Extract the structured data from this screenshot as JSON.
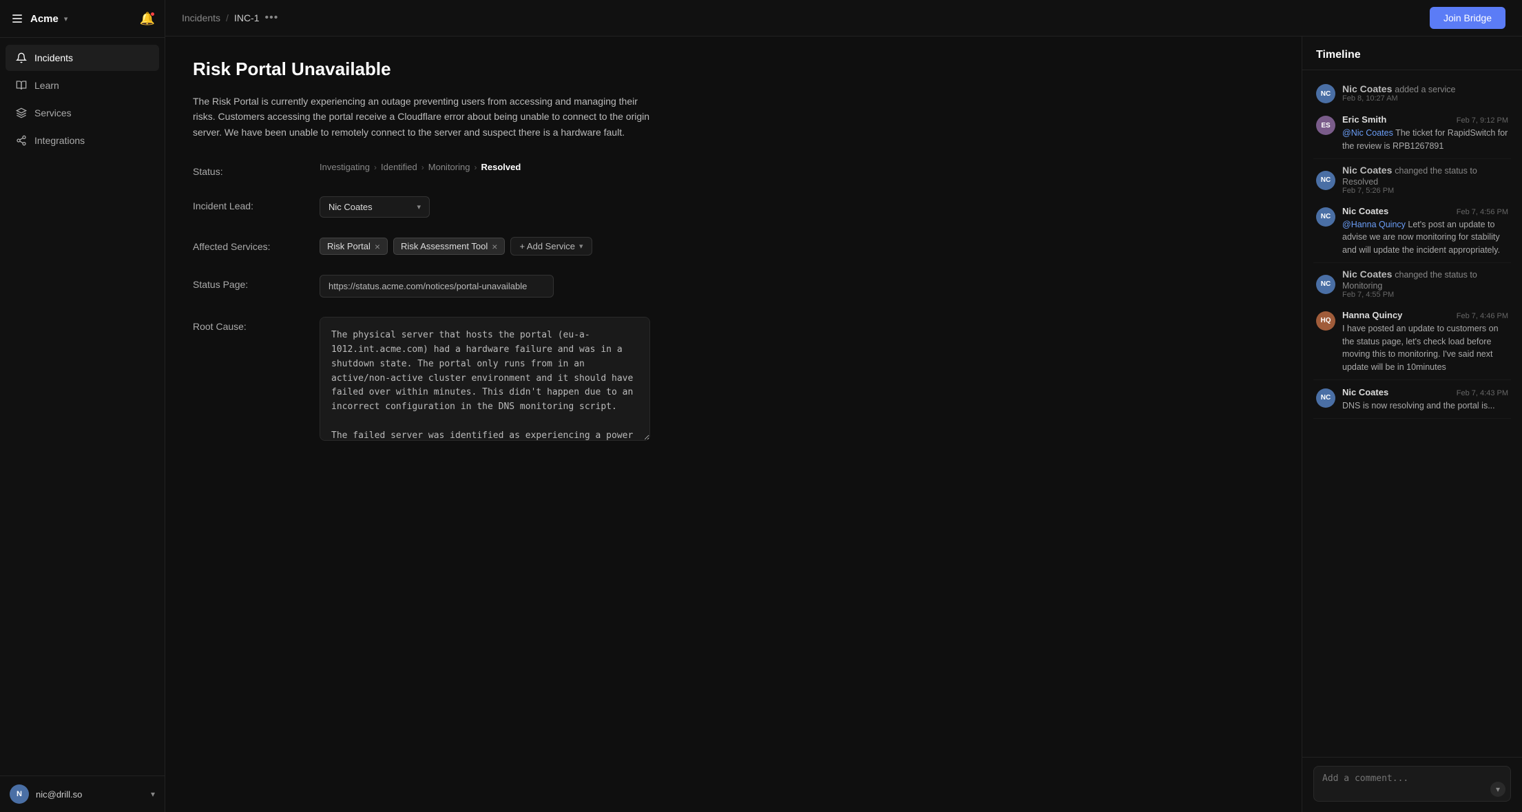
{
  "sidebar": {
    "brand": "Acme",
    "nav_items": [
      {
        "id": "incidents",
        "label": "Incidents",
        "icon": "bell",
        "active": true
      },
      {
        "id": "learn",
        "label": "Learn",
        "icon": "book"
      },
      {
        "id": "services",
        "label": "Services",
        "icon": "layers"
      },
      {
        "id": "integrations",
        "label": "Integrations",
        "icon": "share"
      }
    ],
    "user": {
      "email": "nic@drill.so",
      "initials": "N"
    }
  },
  "topbar": {
    "breadcrumb_parent": "Incidents",
    "breadcrumb_child": "INC-1",
    "join_bridge_label": "Join Bridge"
  },
  "incident": {
    "title": "Risk Portal Unavailable",
    "description": "The Risk Portal is currently experiencing an outage preventing users from accessing and managing their risks. Customers accessing the portal receive a Cloudflare error about being unable to connect to the origin server. We have been unable to remotely connect to the server and suspect there is a hardware fault.",
    "status_label": "Status:",
    "status_steps": [
      "Investigating",
      "Identified",
      "Monitoring",
      "Resolved"
    ],
    "status_current": "Resolved",
    "incident_lead_label": "Incident Lead:",
    "incident_lead_value": "Nic Coates",
    "affected_services_label": "Affected Services:",
    "services": [
      {
        "name": "Risk Portal"
      },
      {
        "name": "Risk Assessment Tool"
      }
    ],
    "add_service_label": "+ Add Service",
    "status_page_label": "Status Page:",
    "status_page_url": "https://status.acme.com/notices/portal-unavailable",
    "root_cause_label": "Root Cause:",
    "root_cause_text": "The physical server that hosts the portal (eu-a-1012.int.acme.com) had a hardware failure and was in a shutdown state. The portal only runs from in an active/non-active cluster environment and it should have failed over within minutes. This didn't happen due to an incorrect configuration in the DNS monitoring script.\n\nThe failed server was identified as experiencing a power surge in the rack which has damaged the motherboard. As a failsafe the server shutdown and will no longer power on."
  },
  "timeline": {
    "title": "Timeline",
    "entries": [
      {
        "type": "simple",
        "name": "Nic Coates",
        "action": "added a service",
        "time": "Feb 8, 10:27 AM",
        "avatar_class": "avatar-nc",
        "initials": "NC"
      },
      {
        "type": "message",
        "name": "Eric Smith",
        "time": "Feb 7, 9:12 PM",
        "mention": "@Nic Coates",
        "text_after_mention": " The ticket for RapidSwitch for the review is RPB1267891",
        "avatar_class": "avatar-es",
        "initials": "ES"
      },
      {
        "type": "simple",
        "name": "Nic Coates",
        "action": "changed the status to Resolved",
        "time": "Feb 7, 5:26 PM",
        "avatar_class": "avatar-nc",
        "initials": "NC"
      },
      {
        "type": "message",
        "name": "Nic Coates",
        "time": "Feb 7, 4:56 PM",
        "mention": "@Hanna Quincy",
        "text_after_mention": " Let's post an update to advise we are now monitoring for stability and will update the incident appropriately.",
        "avatar_class": "avatar-nc",
        "initials": "NC"
      },
      {
        "type": "simple",
        "name": "Nic Coates",
        "action": "changed the status to Monitoring",
        "time": "Feb 7, 4:55 PM",
        "avatar_class": "avatar-nc",
        "initials": "NC"
      },
      {
        "type": "message",
        "name": "Hanna Quincy",
        "time": "Feb 7, 4:46 PM",
        "text_full": "I have posted an update to customers on the status page, let's check load before moving this to monitoring. I've said next update will be in 10minutes",
        "avatar_class": "avatar-hq",
        "initials": "HQ"
      },
      {
        "type": "message",
        "name": "Nic Coates",
        "time": "Feb 7, 4:43 PM",
        "text_full": "DNS is now resolving and the portal is...",
        "avatar_class": "avatar-nc",
        "initials": "NC"
      }
    ],
    "comment_placeholder": "Add a comment..."
  }
}
